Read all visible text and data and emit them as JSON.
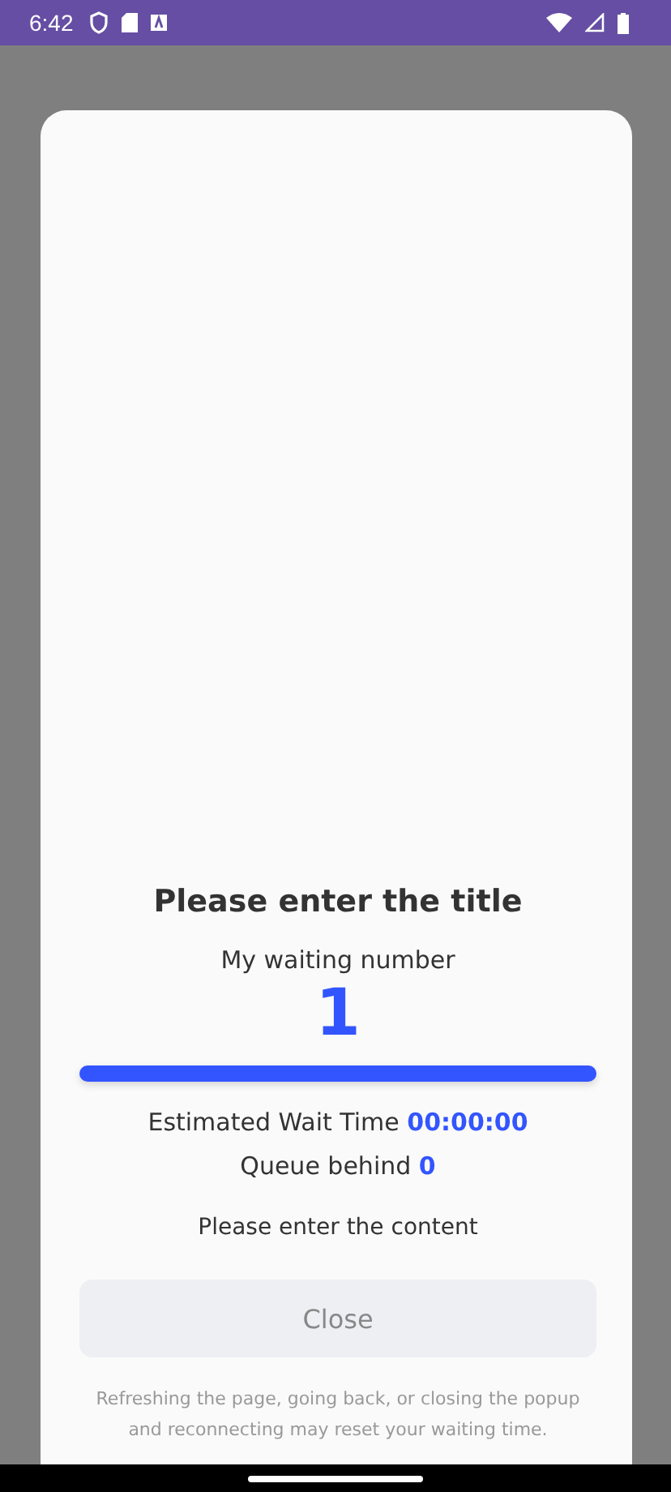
{
  "status_bar": {
    "time": "6:42"
  },
  "popup": {
    "title": "Please enter the title",
    "number_label": "My waiting number",
    "number": "1",
    "progress": {
      "level": 1
    },
    "wait_label": "Estimated Wait Time",
    "wait_value": "00:00:00",
    "queue_label": "Queue behind",
    "queue_value": "0",
    "content": "Please enter the content",
    "close_button": "Close",
    "footnote": "Refreshing the page, going back, or closing the popup and reconnecting may reset your waiting time."
  }
}
